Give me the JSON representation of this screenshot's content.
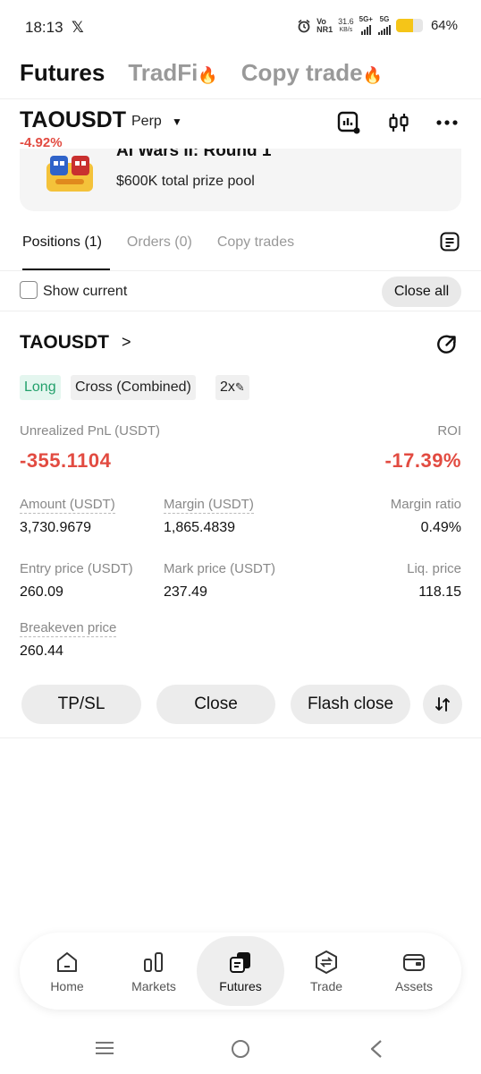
{
  "status_bar": {
    "time": "18:13",
    "x_logo": "𝕏",
    "net_top": "Vo",
    "net_bottom": "NR1",
    "speed": "31.6",
    "speed_unit": "KB/s",
    "sig1": "5G+",
    "sig2": "5G",
    "battery_pct": "64%",
    "battery_level": 0.64,
    "battery_color": "#f5c518"
  },
  "top_tabs": [
    {
      "label": "Futures",
      "active": true
    },
    {
      "label": "TradFi",
      "active": false,
      "hot": true
    },
    {
      "label": "Copy trade",
      "active": false,
      "hot": true
    }
  ],
  "header": {
    "symbol": "TAOUSDT",
    "contract": "Perp",
    "change": "-4.92%",
    "icons": [
      "chart-signal-icon",
      "candlestick-icon",
      "more-icon"
    ]
  },
  "banner": {
    "title": "AI Wars II: Round 1",
    "subtitle": "$600K total prize pool"
  },
  "position_tabs": {
    "tabs": [
      "Positions (1)",
      "Orders (0)",
      "Copy trades"
    ],
    "active_index": 0
  },
  "filter": {
    "show_current_label": "Show current",
    "show_current_checked": false,
    "close_all_label": "Close all"
  },
  "position": {
    "symbol": "TAOUSDT",
    "side": "Long",
    "margin_mode": "Cross (Combined)",
    "leverage": "2x",
    "pnl_label": "Unrealized PnL (USDT)",
    "pnl_value": "-355.1104",
    "roi_label": "ROI",
    "roi_value": "-17.39%",
    "amount_label": "Amount (USDT)",
    "amount_value": "3,730.9679",
    "margin_label": "Margin (USDT)",
    "margin_value": "1,865.4839",
    "margin_ratio_label": "Margin ratio",
    "margin_ratio_value": "0.49%",
    "entry_label": "Entry price (USDT)",
    "entry_value": "260.09",
    "mark_label": "Mark price (USDT)",
    "mark_value": "237.49",
    "liq_label": "Liq. price",
    "liq_value": "118.15",
    "breakeven_label": "Breakeven price",
    "breakeven_value": "260.44",
    "actions": [
      "TP/SL",
      "Close",
      "Flash close"
    ]
  },
  "colors": {
    "negative": "#e24b41",
    "long": "#22a06b",
    "hot": "#f07b2b"
  },
  "bottom_nav": [
    {
      "label": "Home",
      "icon": "home-icon",
      "active": false
    },
    {
      "label": "Markets",
      "icon": "markets-icon",
      "active": false
    },
    {
      "label": "Futures",
      "icon": "futures-icon",
      "active": true
    },
    {
      "label": "Trade",
      "icon": "trade-icon",
      "active": false
    },
    {
      "label": "Assets",
      "icon": "wallet-icon",
      "active": false
    }
  ]
}
